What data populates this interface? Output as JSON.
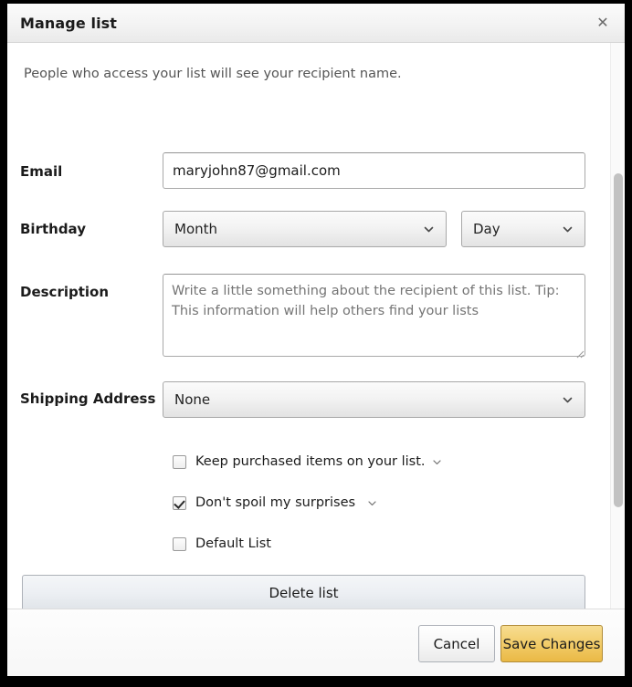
{
  "dialog": {
    "title": "Manage list",
    "close_icon": "close-icon",
    "intro": "People who access your list will see your recipient name."
  },
  "form": {
    "email": {
      "label": "Email",
      "value": "maryjohn87@gmail.com",
      "placeholder": "Email"
    },
    "birthday": {
      "label": "Birthday",
      "month": {
        "value": "Month",
        "icon": "chevron-down-icon"
      },
      "day": {
        "value": "Day",
        "icon": "chevron-down-icon"
      }
    },
    "description": {
      "label": "Description",
      "value": "",
      "placeholder": "Write a little something about the recipient of this list. Tip: This information will help others find your lists"
    },
    "shipping_address": {
      "label": "Shipping Address",
      "value": "None",
      "icon": "chevron-down-icon"
    },
    "checkboxes": [
      {
        "label": "Keep purchased items on your list.",
        "checked": false,
        "has_expander": true,
        "expander_icon": "chevron-down-icon"
      },
      {
        "label": "Don't spoil my surprises",
        "checked": true,
        "has_expander": true,
        "expander_icon": "chevron-down-icon"
      },
      {
        "label": "Default List",
        "checked": false,
        "has_expander": false,
        "expander_icon": ""
      }
    ]
  },
  "actions": {
    "delete_list": "Delete list",
    "cancel": "Cancel",
    "save_changes": "Save Changes"
  },
  "colors": {
    "accent": "#eab945",
    "accent_border": "#b08c3a",
    "text": "#1b1b1b",
    "muted_text": "#767676",
    "border": "#a9a9a9",
    "scrollbar_thumb": "#c2c2c2"
  }
}
